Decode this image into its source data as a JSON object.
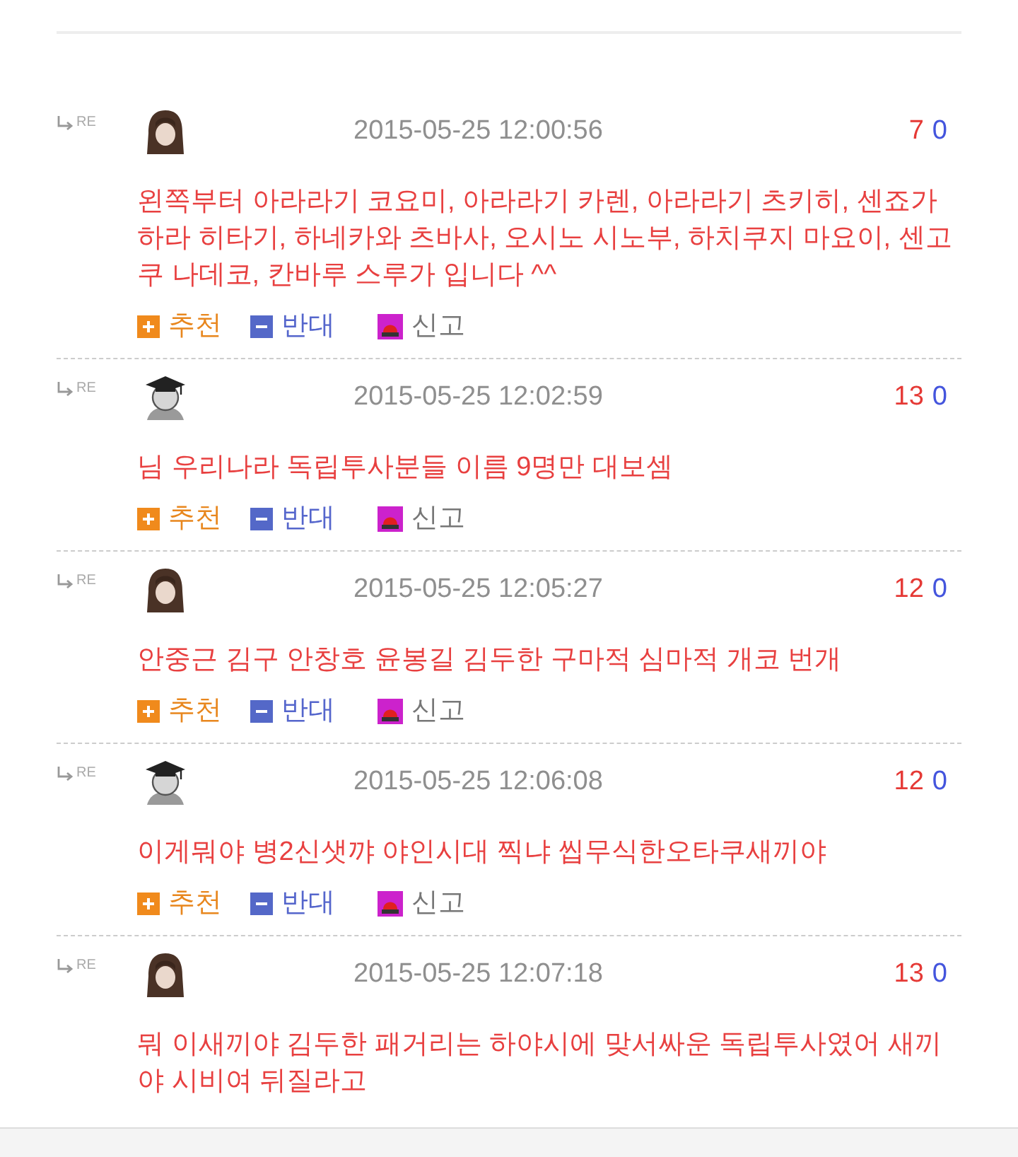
{
  "comments": [
    {
      "re_label": "RE",
      "avatar": {
        "kind": "long-hair"
      },
      "date": "2015-05-25 12:00:56",
      "upvotes": "7",
      "downvotes": "0",
      "text": "왼쪽부터 아라라기 코요미, 아라라기 카렌, 아라라기 츠키히, 센죠가하라 히타기, 하네카와 츠바사, 오시노 시노부, 하치쿠지 마요이, 센고쿠 나데코, 칸바루 스루가 입니다 ^^",
      "actions": [
        {
          "kind": "up",
          "label": "추천"
        },
        {
          "kind": "down",
          "label": "반대"
        },
        {
          "kind": "report",
          "label": "신고"
        }
      ]
    },
    {
      "re_label": "RE",
      "avatar": {
        "kind": "graduate"
      },
      "date": "2015-05-25 12:02:59",
      "upvotes": "13",
      "downvotes": "0",
      "text": "님 우리나라 독립투사분들 이름 9명만 대보셈",
      "actions": [
        {
          "kind": "up",
          "label": "추천"
        },
        {
          "kind": "down",
          "label": "반대"
        },
        {
          "kind": "report",
          "label": "신고"
        }
      ]
    },
    {
      "re_label": "RE",
      "avatar": {
        "kind": "long-hair"
      },
      "date": "2015-05-25 12:05:27",
      "upvotes": "12",
      "downvotes": "0",
      "text": "안중근 김구 안창호 윤봉길 김두한 구마적 심마적 개코 번개",
      "actions": [
        {
          "kind": "up",
          "label": "추천"
        },
        {
          "kind": "down",
          "label": "반대"
        },
        {
          "kind": "report",
          "label": "신고"
        }
      ]
    },
    {
      "re_label": "RE",
      "avatar": {
        "kind": "graduate"
      },
      "date": "2015-05-25 12:06:08",
      "upvotes": "12",
      "downvotes": "0",
      "text": "이게뭐야 병2신샛꺄 야인시대 찍냐 씹무식한오타쿠새끼야",
      "actions": [
        {
          "kind": "up",
          "label": "추천"
        },
        {
          "kind": "down",
          "label": "반대"
        },
        {
          "kind": "report",
          "label": "신고"
        }
      ]
    },
    {
      "re_label": "RE",
      "avatar": {
        "kind": "long-hair"
      },
      "date": "2015-05-25 12:07:18",
      "upvotes": "13",
      "downvotes": "0",
      "text": "뭐 이새끼야 김두한 패거리는 하야시에 맞서싸운 독립투사였어 새끼야 시비여 뒤질라고"
    }
  ]
}
